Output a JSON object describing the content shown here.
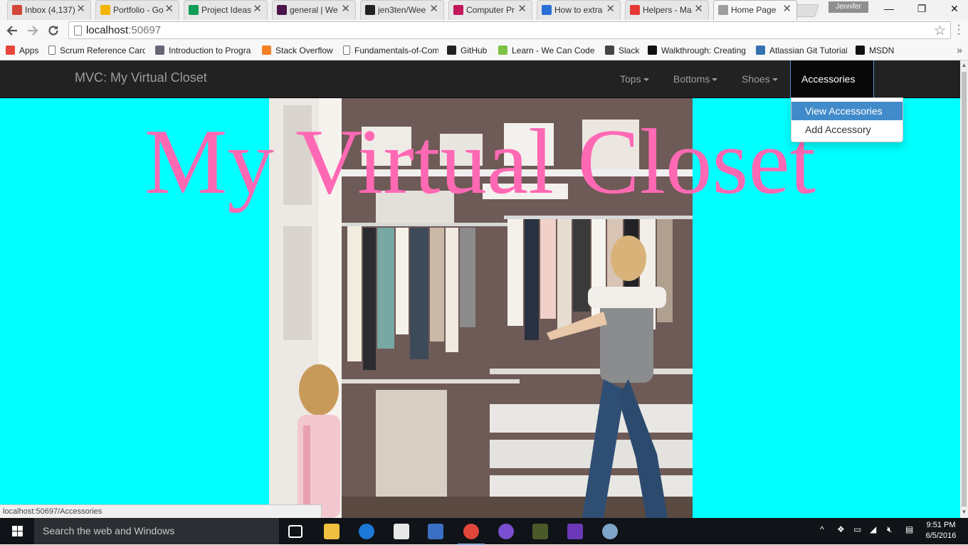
{
  "browser": {
    "tabs": [
      {
        "title": "Inbox (4,137)",
        "color": "#d44638"
      },
      {
        "title": "Portfolio - Go",
        "color": "#f4b400"
      },
      {
        "title": "Project Ideas",
        "color": "#0f9d58"
      },
      {
        "title": "general | We",
        "color": "#4a154b"
      },
      {
        "title": "jen3ten/Wee",
        "color": "#222222"
      },
      {
        "title": "Computer Pr",
        "color": "#c2185b"
      },
      {
        "title": "How to extra",
        "color": "#2a6fd6"
      },
      {
        "title": "Helpers - Ma",
        "color": "#e53935"
      },
      {
        "title": "Home Page",
        "color": "#9e9e9e",
        "active": true
      }
    ],
    "close_glyph": "✕",
    "user_name": "Jennifer",
    "window_controls": {
      "minimize": "—",
      "maximize": "❐",
      "close": "✕"
    },
    "url_host": "localhost",
    "url_port": ":50697",
    "bookmarks": [
      {
        "label": "Apps",
        "icon": "apps-grid-icon"
      },
      {
        "label": "Scrum Reference Card",
        "icon": "page-icon"
      },
      {
        "label": "Introduction to Progra",
        "icon": "airplane-icon"
      },
      {
        "label": "Stack Overflow",
        "icon": "stackoverflow-icon"
      },
      {
        "label": "Fundamentals-of-Com",
        "icon": "page-icon"
      },
      {
        "label": "GitHub",
        "icon": "github-icon"
      },
      {
        "label": "Learn - We Can Code",
        "icon": "wecancode-icon"
      },
      {
        "label": "Slack",
        "icon": "slack-icon"
      },
      {
        "label": "Walkthrough: Creating",
        "icon": "msdn-m-icon"
      },
      {
        "label": "Atlassian Git Tutorial",
        "icon": "atlassian-icon"
      },
      {
        "label": "MSDN",
        "icon": "msdn-m-icon"
      }
    ],
    "bookmarks_more": "»",
    "status_url": "localhost:50697/Accessories"
  },
  "site": {
    "brand": "MVC: My Virtual Closet",
    "nav": [
      {
        "label": "Tops"
      },
      {
        "label": "Bottoms"
      },
      {
        "label": "Shoes"
      },
      {
        "label": "Accessories",
        "open": true
      }
    ],
    "dropdown": [
      "View Accessories",
      "Add Accessory"
    ],
    "hero_title": "My Virtual Closet",
    "background_color": "#00ffff",
    "title_color": "#ff69b4"
  },
  "taskbar": {
    "search_placeholder": "Search the web and Windows",
    "time": "9:51 PM",
    "date": "6/5/2016"
  }
}
